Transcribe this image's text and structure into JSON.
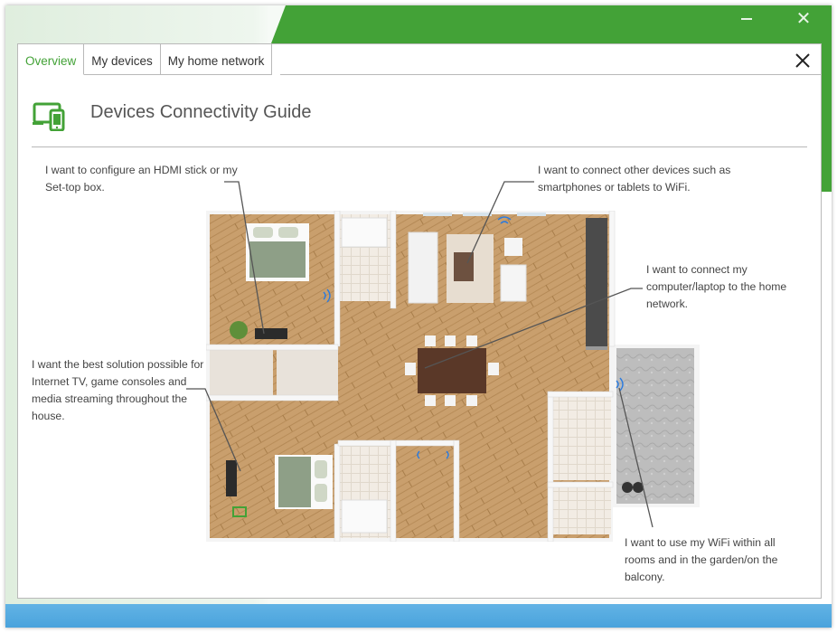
{
  "window": {
    "minimize_glyph": "",
    "close_glyph": "✕",
    "colors": {
      "accent": "#43a237",
      "bottom_bar": "#56abe1"
    }
  },
  "tabs": [
    {
      "label": "Overview",
      "active": true
    },
    {
      "label": "My devices",
      "active": false
    },
    {
      "label": "My home network",
      "active": false
    }
  ],
  "dialog": {
    "title": "Devices Connectivity Guide",
    "close_icon": "close-x-icon",
    "guide_icon": "devices-icon"
  },
  "callouts": {
    "hdmi": "I want to configure an HDMI stick or my Set-top box.",
    "smartphones": "I want to connect other devices such as smartphones or tablets to WiFi.",
    "computer": "I want to connect my computer/laptop to the home network.",
    "internet_tv": "I want the best solution possible for Internet TV, game consoles and media streaming throughout the house.",
    "wifi_rooms": "I want to use my WiFi within all rooms and in the garden/on the balcony."
  }
}
